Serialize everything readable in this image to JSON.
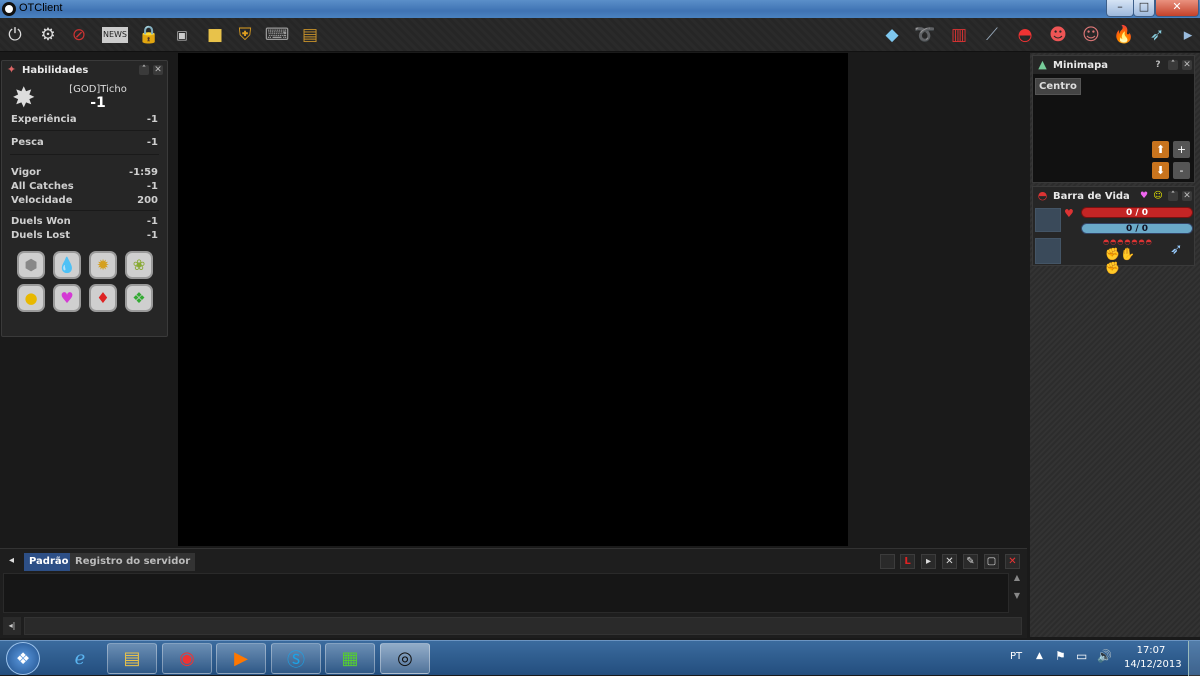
{
  "window": {
    "title": "OTClient"
  },
  "toolbar": {
    "left_icons": [
      "power-icon",
      "gear-icon",
      "prohibited-icon",
      "news-icon",
      "lock-icon",
      "terminal-icon",
      "box-icon",
      "shield-icon",
      "keyboard-icon",
      "chest-icon"
    ],
    "right_icons": [
      "diamond-icon",
      "rope-icon",
      "pokedex-icon",
      "fishing-rod-icon",
      "pokeball-icon",
      "trainer-icon",
      "character-icon",
      "fire-icon",
      "fly-icon",
      "scroll-icon"
    ]
  },
  "skills": {
    "header": "Habilidades",
    "player_name": "[GOD]Ticho",
    "level": "-1",
    "rows": [
      {
        "label": "Experiência",
        "value": "-1"
      },
      {
        "label": "Pesca",
        "value": "-1"
      },
      {
        "label": "Vigor",
        "value": "-1:59"
      },
      {
        "label": "All Catches",
        "value": "-1"
      },
      {
        "label": "Velocidade",
        "value": "200"
      },
      {
        "label": "Duels Won",
        "value": "-1"
      },
      {
        "label": "Duels Lost",
        "value": "-1"
      }
    ],
    "medals": [
      "boulder-badge-icon",
      "cascade-badge-icon",
      "thunder-badge-icon",
      "rainbow-badge-icon",
      "soul-badge-icon",
      "marsh-badge-icon",
      "volcano-badge-icon",
      "earth-badge-icon"
    ]
  },
  "minimap": {
    "header": "Minimapa",
    "help": "?",
    "center_label": "Centro",
    "zoom_in": "+",
    "zoom_out": "-"
  },
  "lifebar": {
    "header": "Barra de Vida",
    "hp": "0 / 0",
    "mana": "0 / 0"
  },
  "console": {
    "tabs": [
      "Padrão",
      "Registro do servidor"
    ],
    "active_tab": "Padrão"
  },
  "taskbar": {
    "lang": "PT",
    "time": "17:07",
    "date": "14/12/2013"
  },
  "colors": {
    "title_bar": "#4a82c0",
    "active_tab": "#2d4f86",
    "hp_bar": "#c42525",
    "mana_bar": "#6aa9c8"
  }
}
